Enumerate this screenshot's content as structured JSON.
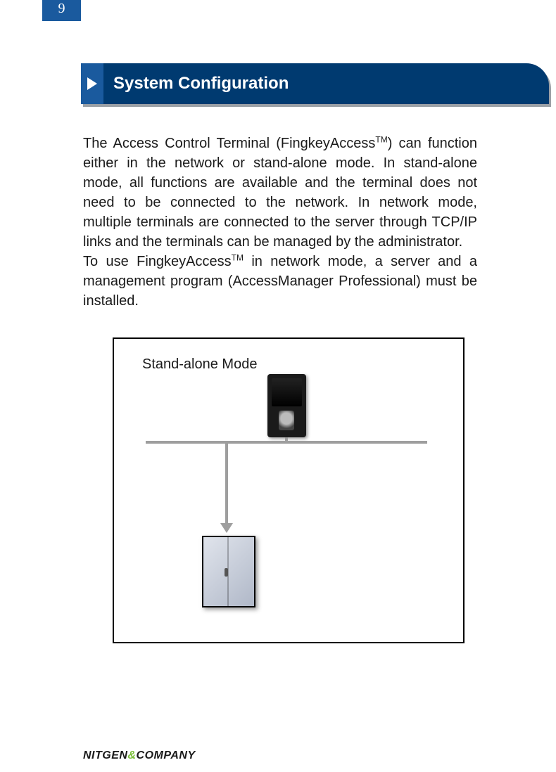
{
  "page_number": "9",
  "heading": "System Configuration",
  "paragraph": {
    "p1a": "The Access Control Terminal (FingkeyAccess",
    "tm": "TM",
    "p1b": ") can function either in the network or stand-alone mode. In stand-alone mode, all functions are available and the terminal does not need to be connected to the network. In network mode, multiple terminals are connected to the server through TCP/IP links and the terminals can be managed by the administrator.",
    "p2a": "To use FingkeyAccess",
    "p2b": " in network mode, a server and a management program (AccessManager Professional) must be installed."
  },
  "diagram": {
    "title": "Stand-alone Mode"
  },
  "footer": {
    "brand_a": "NITGEN",
    "brand_amp": "&",
    "brand_b": "COMPANY"
  }
}
